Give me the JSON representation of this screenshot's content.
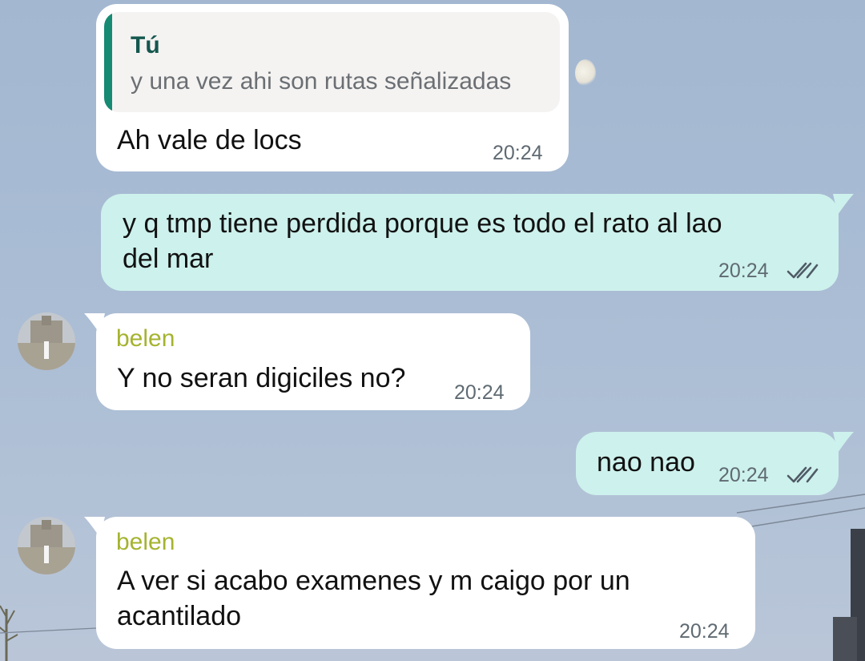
{
  "messages": [
    {
      "type": "outgoing-reply",
      "quote": {
        "author": "Tú",
        "text": "y una vez ahi son rutas señalizadas"
      },
      "text": "Ah vale de locs",
      "time": "20:24"
    },
    {
      "type": "outgoing",
      "lines": [
        "y q tmp tiene perdida porque es todo el rato al lao",
        "del mar"
      ],
      "time": "20:24",
      "status": "read"
    },
    {
      "type": "incoming",
      "sender": "belen",
      "text": "Y no seran digiciles no?",
      "time": "20:24"
    },
    {
      "type": "outgoing",
      "text": "nao nao",
      "time": "20:24",
      "status": "read"
    },
    {
      "type": "incoming",
      "sender": "belen",
      "lines": [
        "A ver si acabo examenes y m caigo por un",
        "acantilado"
      ],
      "time": "20:24"
    }
  ],
  "colors": {
    "incoming_bubble": "#ffffff",
    "outgoing_bubble": "#cdf1ec",
    "sender_name": "#a5b32f",
    "quote_bar": "#168a73",
    "quote_author": "#14574e"
  },
  "icons": {
    "read_status": "double-check-icon",
    "avatar": "avatar-photo"
  }
}
